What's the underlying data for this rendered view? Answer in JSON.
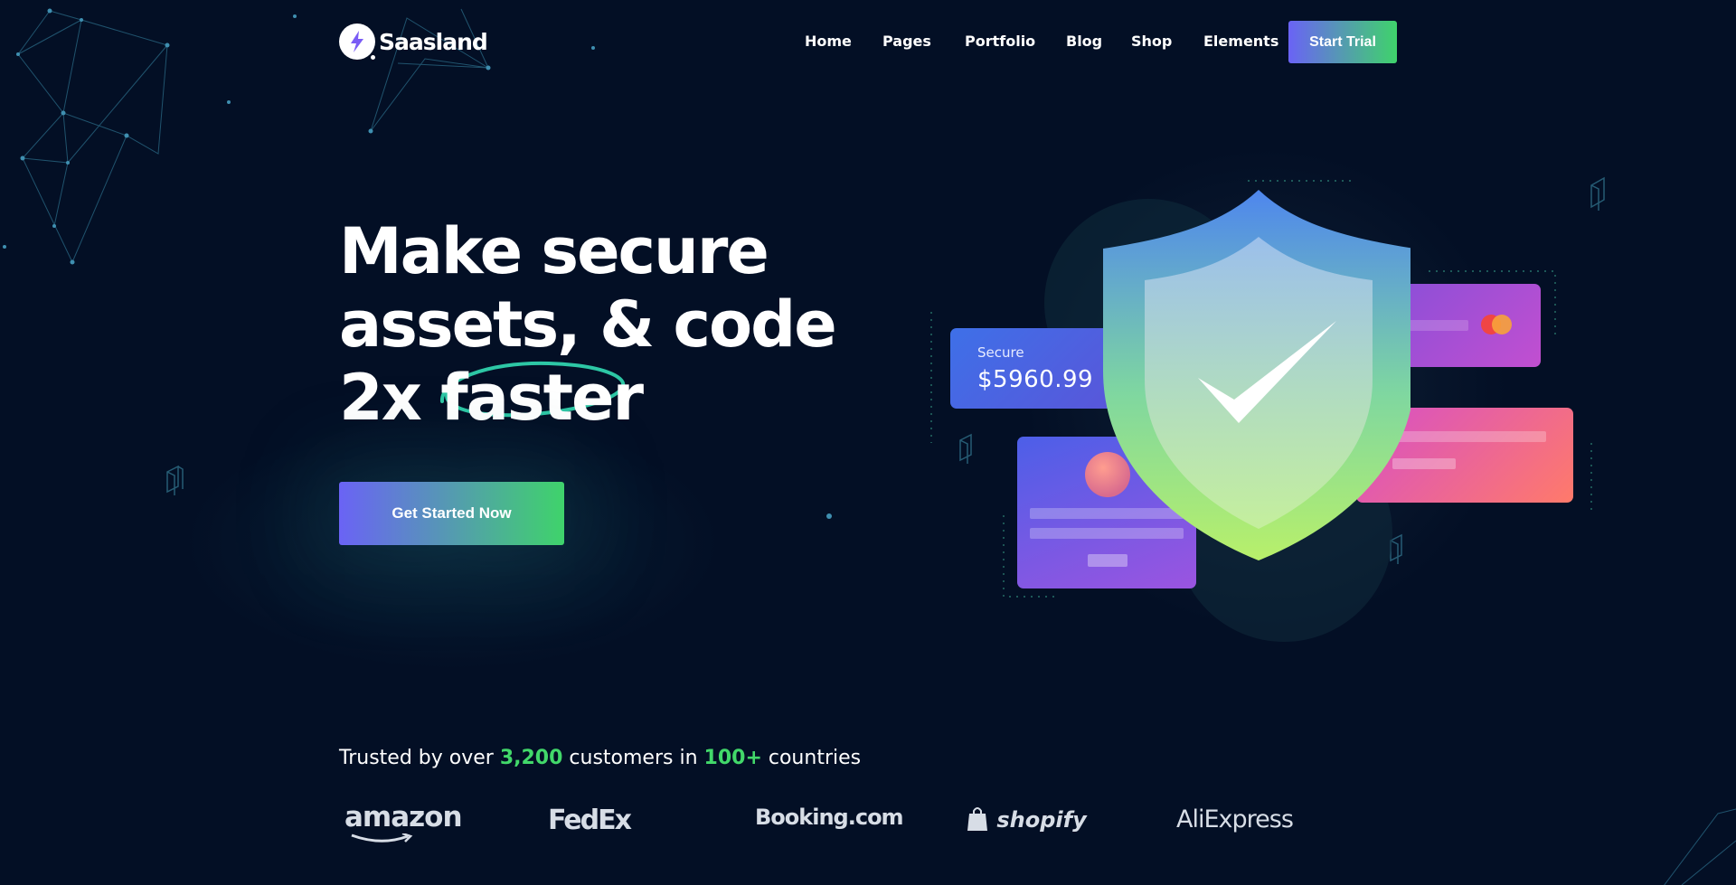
{
  "header": {
    "logo_text": "Saasland",
    "nav": [
      "Home",
      "Pages",
      "Portfolio",
      "Blog",
      "Shop",
      "Elements"
    ],
    "cta": "Start Trial"
  },
  "hero": {
    "line1": "Make secure",
    "line2": "assets, & code",
    "line3_prefix": "2x",
    "line3_accent": "faster",
    "button": "Get Started Now"
  },
  "illustration": {
    "secure_label": "Secure",
    "secure_amount": "$5960.99"
  },
  "trust": {
    "prefix": "Trusted by over",
    "customers": "3,200",
    "middle": "customers in",
    "countries": "100+",
    "suffix": "countries"
  },
  "brands": [
    "amazon",
    "FedEx",
    "Booking.com",
    "shopify",
    "AliExpress"
  ],
  "colors": {
    "background": "#030f25",
    "gradient_start": "#6a63f5",
    "gradient_end": "#3fd36b",
    "highlight": "#42d86a"
  }
}
